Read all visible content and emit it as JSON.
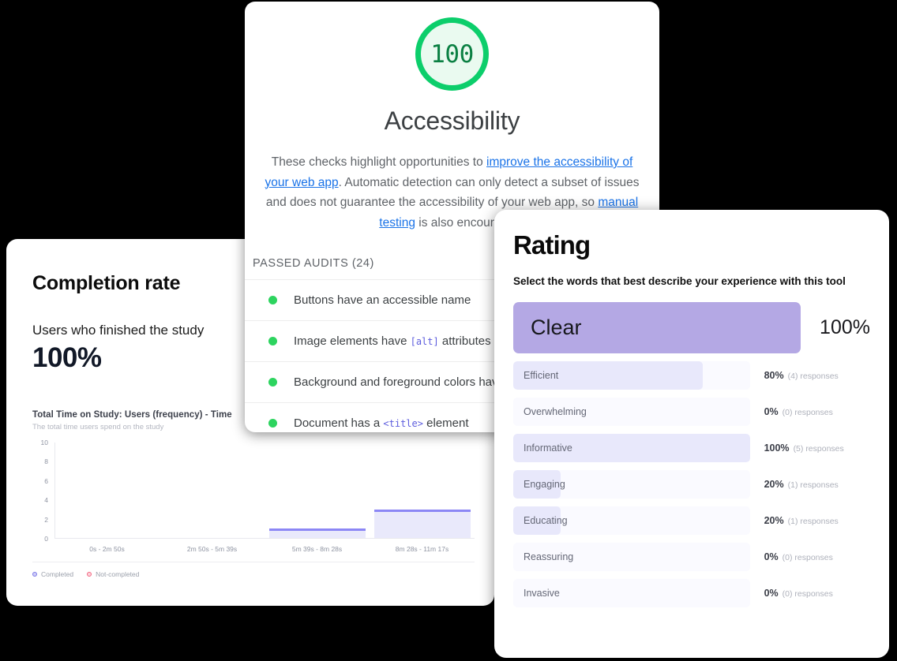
{
  "completion": {
    "title": "Completion rate",
    "subtitle": "Users who finished the study",
    "value": "100%",
    "chart_data": {
      "type": "bar",
      "title": "Total Time on Study: Users (frequency) - Time",
      "subtitle": "The total time users spend on the study",
      "categories": [
        "0s - 2m 50s",
        "2m 50s - 5m 39s",
        "5m 39s - 8m 28s",
        "8m 28s - 11m 17s"
      ],
      "series": [
        {
          "name": "Completed",
          "values": [
            0,
            0,
            1,
            3
          ],
          "color": "#8c87f5"
        },
        {
          "name": "Not-completed",
          "values": [
            0,
            0,
            0,
            0
          ],
          "color": "#f2647f"
        }
      ],
      "xlabel": "",
      "ylabel": "",
      "ylim": [
        0,
        10
      ],
      "yticks": [
        "10",
        "8",
        "6",
        "4",
        "2",
        "0"
      ],
      "grid": false,
      "legend_position": "bottom-left",
      "legend": [
        "Completed",
        "Not-completed"
      ]
    }
  },
  "accessibility": {
    "score": "100",
    "title": "Accessibility",
    "description_parts": [
      {
        "text": "These checks highlight opportunities to ",
        "link": false
      },
      {
        "text": "improve the accessibility of your web app",
        "link": true
      },
      {
        "text": ". Automatic detection can only detect a subset of issues and does not guarantee the accessibility of your web app, so ",
        "link": false
      },
      {
        "text": "manual testing",
        "link": true
      },
      {
        "text": " is also encouraged.",
        "link": false
      }
    ],
    "passed_audits_header": "PASSED AUDITS (24)",
    "audits": [
      {
        "pre": "Buttons have an accessible name",
        "code": "",
        "post": ""
      },
      {
        "pre": "Image elements have ",
        "code": "[alt]",
        "post": " attributes"
      },
      {
        "pre": "Background and foreground colors have a",
        "code": "",
        "post": ""
      },
      {
        "pre": "Document has a ",
        "code": "<title>",
        "post": " element"
      }
    ],
    "score_ring_color": "#0cce6b",
    "score_text_color": "#0b8043"
  },
  "rating": {
    "title": "Rating",
    "subtitle": "Select the words that best describe your experience with this tool",
    "top_word": {
      "label": "Clear",
      "percent": "100%"
    },
    "words": [
      {
        "label": "Efficient",
        "percent": "80%",
        "responses": "(4) responses",
        "fill": 80
      },
      {
        "label": "Overwhelming",
        "percent": "0%",
        "responses": "(0) responses",
        "fill": 0
      },
      {
        "label": "Informative",
        "percent": "100%",
        "responses": "(5) responses",
        "fill": 100
      },
      {
        "label": "Engaging",
        "percent": "20%",
        "responses": "(1) responses",
        "fill": 20
      },
      {
        "label": "Educating",
        "percent": "20%",
        "responses": "(1) responses",
        "fill": 20
      },
      {
        "label": "Reassuring",
        "percent": "0%",
        "responses": "(0) responses",
        "fill": 0
      },
      {
        "label": "Invasive",
        "percent": "0%",
        "responses": "(0) responses",
        "fill": 0
      }
    ],
    "accent_color": "#b4a8e4",
    "fill_color": "#e8e8fb",
    "track_color": "#fafaff"
  }
}
